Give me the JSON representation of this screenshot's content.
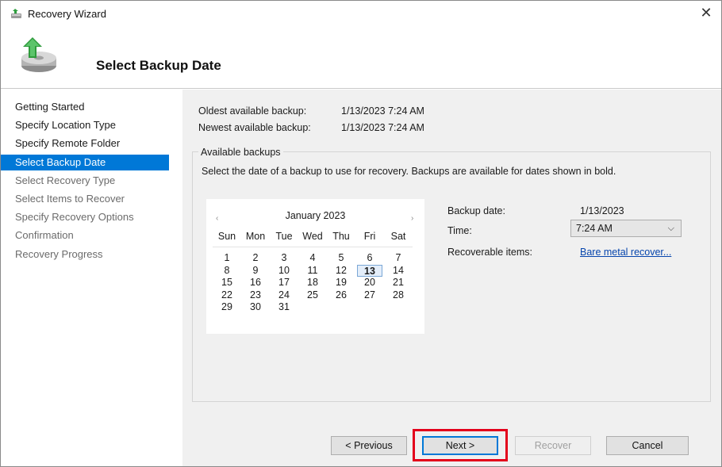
{
  "window": {
    "title": "Recovery Wizard",
    "close_glyph": "✕",
    "page_title": "Select Backup Date"
  },
  "sidebar": {
    "items": [
      {
        "label": "Getting Started",
        "state": "done"
      },
      {
        "label": "Specify Location Type",
        "state": "done"
      },
      {
        "label": "Specify Remote Folder",
        "state": "done"
      },
      {
        "label": "Select Backup Date",
        "state": "active"
      },
      {
        "label": "Select Recovery Type",
        "state": "todo"
      },
      {
        "label": "Select Items to Recover",
        "state": "todo"
      },
      {
        "label": "Specify Recovery Options",
        "state": "todo"
      },
      {
        "label": "Confirmation",
        "state": "todo"
      },
      {
        "label": "Recovery Progress",
        "state": "todo"
      }
    ]
  },
  "info": {
    "oldest_label": "Oldest available backup:",
    "oldest_value": "1/13/2023 7:24 AM",
    "newest_label": "Newest available backup:",
    "newest_value": "1/13/2023 7:24 AM"
  },
  "backups": {
    "group_title": "Available backups",
    "description": "Select the date of a backup to use for recovery. Backups are available for dates shown in bold.",
    "calendar": {
      "month": "January 2023",
      "prev_glyph": "‹",
      "next_glyph": "›",
      "weekdays": [
        "Sun",
        "Mon",
        "Tue",
        "Wed",
        "Thu",
        "Fri",
        "Sat"
      ],
      "weeks": [
        [
          "1",
          "2",
          "3",
          "4",
          "5",
          "6",
          "7"
        ],
        [
          "8",
          "9",
          "10",
          "11",
          "12",
          "13",
          "14"
        ],
        [
          "15",
          "16",
          "17",
          "18",
          "19",
          "20",
          "21"
        ],
        [
          "22",
          "23",
          "24",
          "25",
          "26",
          "27",
          "28"
        ],
        [
          "29",
          "30",
          "31",
          "",
          "",
          "",
          ""
        ]
      ],
      "selected_day": "13"
    },
    "backup_date_label": "Backup date:",
    "backup_date_value": "1/13/2023",
    "time_label": "Time:",
    "time_value": "7:24 AM",
    "recoverable_label": "Recoverable items:",
    "recoverable_link": "Bare metal recover..."
  },
  "buttons": {
    "previous": "< Previous",
    "next": "Next >",
    "recover": "Recover",
    "cancel": "Cancel"
  },
  "colors": {
    "accent": "#0078d7",
    "highlight": "#e3001b"
  }
}
